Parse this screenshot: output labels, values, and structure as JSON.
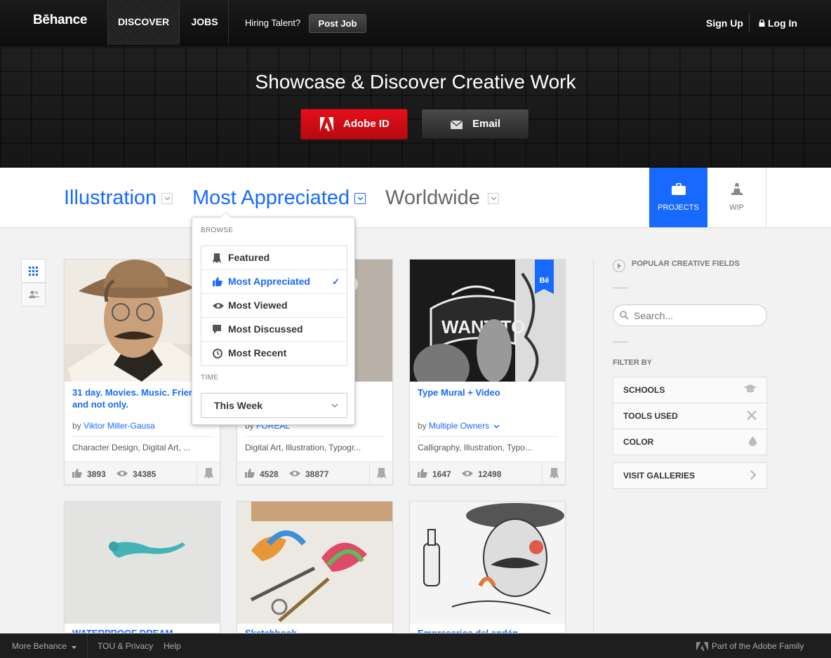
{
  "nav": {
    "logo": "Bēhance",
    "discover": "DISCOVER",
    "jobs": "JOBS",
    "hiring": "Hiring Talent?",
    "post_job": "Post Job",
    "sign_up": "Sign Up",
    "log_in": "Log In"
  },
  "hero": {
    "title": "Showcase & Discover Creative Work",
    "adobe_button": "Adobe ID",
    "email_button": "Email"
  },
  "filters": {
    "field": "Illustration",
    "sort": "Most Appreciated",
    "location": "Worldwide",
    "tab_projects": "PROJECTS",
    "tab_wip": "WIP"
  },
  "dropdown": {
    "browse_heading": "BROWSE",
    "items": [
      {
        "label": "Featured",
        "icon": "ribbon-icon"
      },
      {
        "label": "Most Appreciated",
        "icon": "thumbs-up-icon",
        "selected": true
      },
      {
        "label": "Most Viewed",
        "icon": "eye-icon"
      },
      {
        "label": "Most Discussed",
        "icon": "comment-icon"
      },
      {
        "label": "Most Recent",
        "icon": "clock-icon"
      }
    ],
    "time_heading": "TIME",
    "time_value": "This Week",
    "check": "✓"
  },
  "cards": [
    {
      "title": "31 day. Movies. Music. Friends and not only.",
      "by": "by",
      "owner": "Viktor Miller-Gausa",
      "fields": "Character Design, Digital Art, ...",
      "appreciations": "3893",
      "views": "34385"
    },
    {
      "title": "",
      "by": "by",
      "owner": "FOREAL",
      "fields": "Digital Art, Illustration, Typogr...",
      "appreciations": "4528",
      "views": "38877"
    },
    {
      "title": "Type Mural + Video",
      "by": "by",
      "owner": "Multiple Owners",
      "fields": "Calligraphy, Illustration, Typo...",
      "appreciations": "1647",
      "views": "12498",
      "badge": "Bē"
    },
    {
      "title": "WATERPROOF DREAM"
    },
    {
      "title": "Sketchbook"
    },
    {
      "title": "Empresarios del andén"
    }
  ],
  "sidebar": {
    "popular": "POPULAR CREATIVE FIELDS",
    "search_placeholder": "Search...",
    "filter_by": "FILTER BY",
    "schools": "SCHOOLS",
    "tools": "TOOLS USED",
    "color": "COLOR",
    "galleries": "VISIT GALLERIES"
  },
  "footer": {
    "more": "More Behance",
    "tou": "TOU & Privacy",
    "help": "Help",
    "adobe_family": "Part of the Adobe Family"
  },
  "colors": {
    "accent_blue": "#1769ff",
    "adobe_red": "#e3101b",
    "dark_nav": "#111111"
  }
}
